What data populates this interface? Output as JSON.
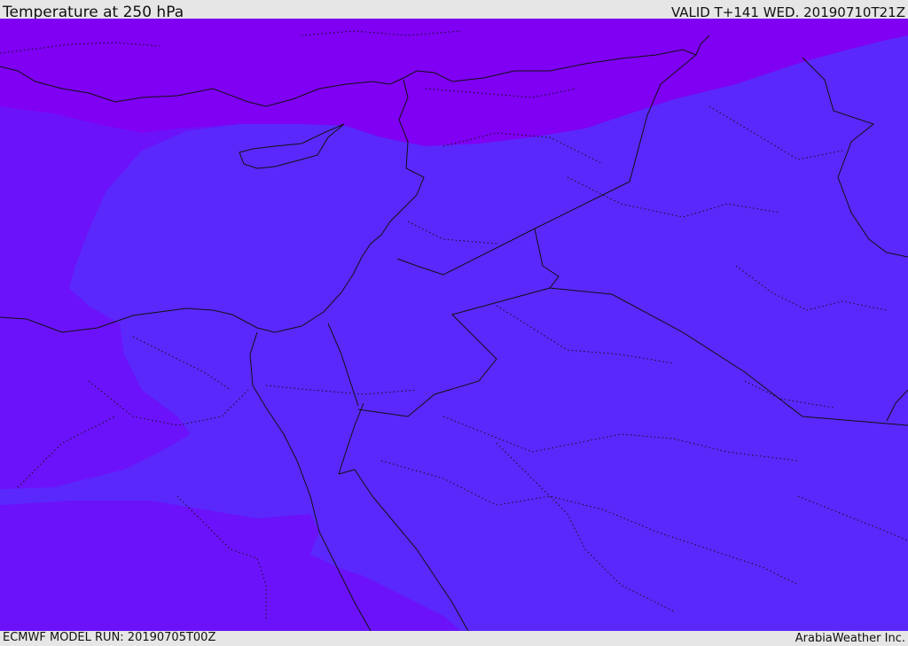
{
  "header": {
    "title": "Temperature at 250 hPa",
    "valid_time": "VALID T+141 WED. 20190710T21Z"
  },
  "footer": {
    "model_run": "ECMWF MODEL RUN: 20190705T00Z",
    "credit": "ArabiaWeather Inc."
  },
  "map": {
    "field": "Temperature at 250 hPa",
    "colors": {
      "coldest": "#7f00f2",
      "cold": "#6c12fa",
      "mild": "#5a28fb",
      "border": "#111111"
    }
  }
}
